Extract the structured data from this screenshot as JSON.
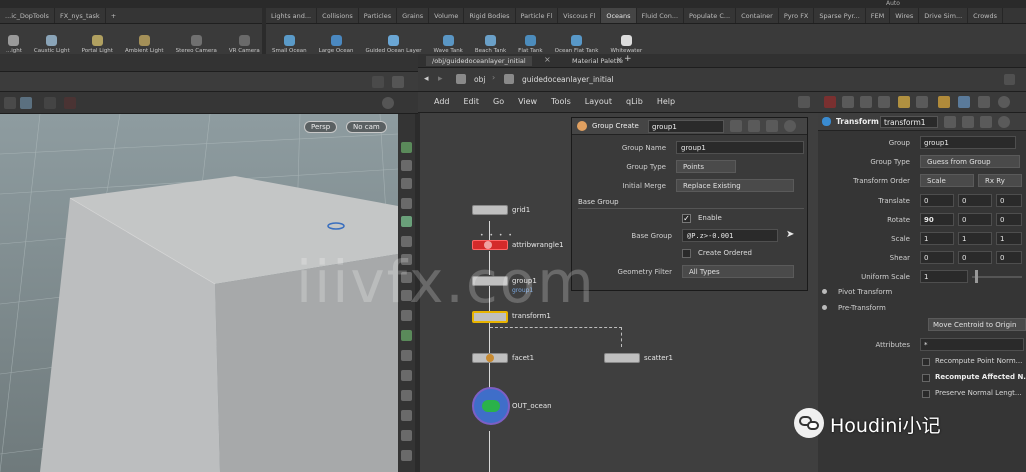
{
  "shelf_left": {
    "tabs": [
      "...ic_DopTools",
      "FX_nys_task"
    ],
    "tools": [
      "...ight",
      "Caustic Light",
      "Portal Light",
      "Ambient Light",
      "Stereo Camera",
      "VR Camera"
    ]
  },
  "shelf_right": {
    "tabs": [
      "Lights and...",
      "Collisions",
      "Particles",
      "Grains",
      "Volume",
      "Rigid Bodies",
      "Particle Fl",
      "Viscous Fl",
      "Oceans",
      "Fluid Con...",
      "Populate C...",
      "Container",
      "Pyro FX",
      "Sparse Pyr...",
      "FEM",
      "Wires",
      "Drive Sim...",
      "Crowds"
    ],
    "active_tab": "Oceans",
    "tools": [
      "Small Ocean",
      "Large Ocean",
      "Guided Ocean Layer",
      "Wave Tank",
      "Beach Tank",
      "Flat Tank",
      "Ocean Flat Tank",
      "Whitewater"
    ],
    "top_right_label": "Auto"
  },
  "pane_tabs": {
    "path_tab": "/obj/guidedoceanlayer_initial",
    "material_tab": "Material Palette"
  },
  "network_path": {
    "context": "obj",
    "node": "guidedoceanlayer_initial"
  },
  "network_menu": [
    "Add",
    "Edit",
    "Go",
    "View",
    "Tools",
    "Layout",
    "qLib",
    "Help"
  ],
  "viewport": {
    "persp_label": "Persp",
    "cam_label": "No cam"
  },
  "nodes": {
    "grid": "grid1",
    "attribwrangle": "attribwrangle1",
    "group": "group1",
    "group_sub": "group1",
    "transform": "transform1",
    "facet": "facet1",
    "scatter": "scatter1",
    "out": "OUT_ocean"
  },
  "group_dialog": {
    "title": "Group Create",
    "node_name": "group1",
    "group_name_label": "Group Name",
    "group_name": "group1",
    "group_type_label": "Group Type",
    "group_type": "Points",
    "initial_merge_label": "Initial Merge",
    "initial_merge": "Replace Existing",
    "base_group_header": "Base Group",
    "enable_label": "Enable",
    "base_group_label": "Base Group",
    "base_group_expr": "@P.z>-0.001",
    "create_ordered_label": "Create Ordered",
    "geometry_filter_label": "Geometry Filter",
    "geometry_filter": "All Types"
  },
  "transform_params": {
    "type": "Transform",
    "name": "transform1",
    "group_label": "Group",
    "group_value": "group1",
    "group_type_label": "Group Type",
    "group_type_value": "Guess from Group",
    "transform_order_label": "Transform Order",
    "transform_order_a": "Scale",
    "transform_order_b": "Rx Ry",
    "translate_label": "Translate",
    "translate": [
      "0",
      "0",
      "0"
    ],
    "rotate_label": "Rotate",
    "rotate": [
      "90",
      "0",
      "0"
    ],
    "scale_label": "Scale",
    "scale": [
      "1",
      "1",
      "1"
    ],
    "shear_label": "Shear",
    "shear": [
      "0",
      "0",
      "0"
    ],
    "uniform_scale_label": "Uniform Scale",
    "uniform_scale": "1",
    "pivot_label": "Pivot Transform",
    "pre_label": "Pre-Transform",
    "move_centroid": "Move Centroid to Origin",
    "attributes_label": "Attributes",
    "attributes_value": "*",
    "recompute_normals": "Recompute Point Norm...",
    "recompute_affected": "Recompute Affected N...",
    "preserve_normal": "Preserve Normal Lengt..."
  },
  "watermark": "iiivfx.com",
  "brand": "Houdini小记",
  "colors": {
    "attribwrangle": "#d42a2a",
    "active_tab": "#4a4a4a",
    "out_node": "#3f6ec9",
    "out_ring": "#2ab24a",
    "transform_outline": "#e8b400"
  }
}
